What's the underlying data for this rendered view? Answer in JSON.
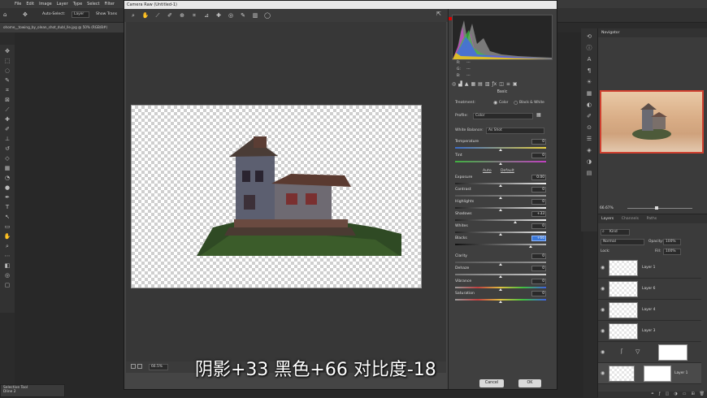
{
  "menubar": {
    "items": [
      "File",
      "Edit",
      "Image",
      "Layer",
      "Type",
      "Select",
      "Filter"
    ]
  },
  "options": {
    "autoselect_label": "Auto-Select:",
    "autoselect_value": "Layer",
    "show_transform": "Show Trans"
  },
  "document": {
    "tab_title": "ohome__towing_by_olean_shot_dubl_lle.jpg @ 50% (RGB/8#)"
  },
  "dialog": {
    "title": "Camera Raw (Untitled-1)",
    "rgb": {
      "r_label": "R:",
      "g_label": "G:",
      "b_label": "B:",
      "r": "---",
      "g": "---",
      "b": "---"
    },
    "section": "Basic",
    "treatment_label": "Treatment:",
    "treatment_color": "Color",
    "treatment_bw": "Black & White",
    "profile_label": "Profile:",
    "profile_value": "Color",
    "wb_label": "White Balance:",
    "wb_value": "As Shot",
    "auto_label": "Auto",
    "default_label": "Default",
    "zoom": "66.5%",
    "cancel": "Cancel",
    "ok": "OK",
    "sliders": [
      {
        "label": "Temperature",
        "value": "0",
        "pos": 0.5
      },
      {
        "label": "Tint",
        "value": "0",
        "pos": 0.5
      },
      {
        "label": "Exposure",
        "value": "0.00",
        "pos": 0.5
      },
      {
        "label": "Contrast",
        "value": "0",
        "pos": 0.5
      },
      {
        "label": "Highlights",
        "value": "0",
        "pos": 0.5
      },
      {
        "label": "Shadows",
        "value": "+33",
        "pos": 0.66
      },
      {
        "label": "Whites",
        "value": "0",
        "pos": 0.5
      },
      {
        "label": "Blacks",
        "value": "+66",
        "pos": 0.83
      },
      {
        "label": "Clarity",
        "value": "0",
        "pos": 0.5
      },
      {
        "label": "Dehaze",
        "value": "0",
        "pos": 0.5
      },
      {
        "label": "Vibrance",
        "value": "0",
        "pos": 0.5
      },
      {
        "label": "Saturation",
        "value": "0",
        "pos": 0.5
      }
    ]
  },
  "navigator": {
    "title": "Navigator",
    "zoom": "66.67%"
  },
  "layers": {
    "tabs": [
      "Layers",
      "Channels",
      "Paths"
    ],
    "kind": "Kind",
    "blend": "Normal",
    "opacity_label": "Opacity:",
    "opacity": "100%",
    "lock_label": "Lock:",
    "fill_label": "Fill:",
    "fill": "100%",
    "rows": [
      "Layer 1",
      "Layer 6",
      "Layer 4",
      "Layer 3",
      "",
      "Layer 1"
    ]
  },
  "mini_panel": {
    "title": "Selective Tool",
    "value": "Dline 2"
  },
  "subtitle": "阴影+33 黑色+66 对比度-18",
  "colors": {
    "accent": "#3b78d8",
    "ps_bg": "#282828"
  }
}
